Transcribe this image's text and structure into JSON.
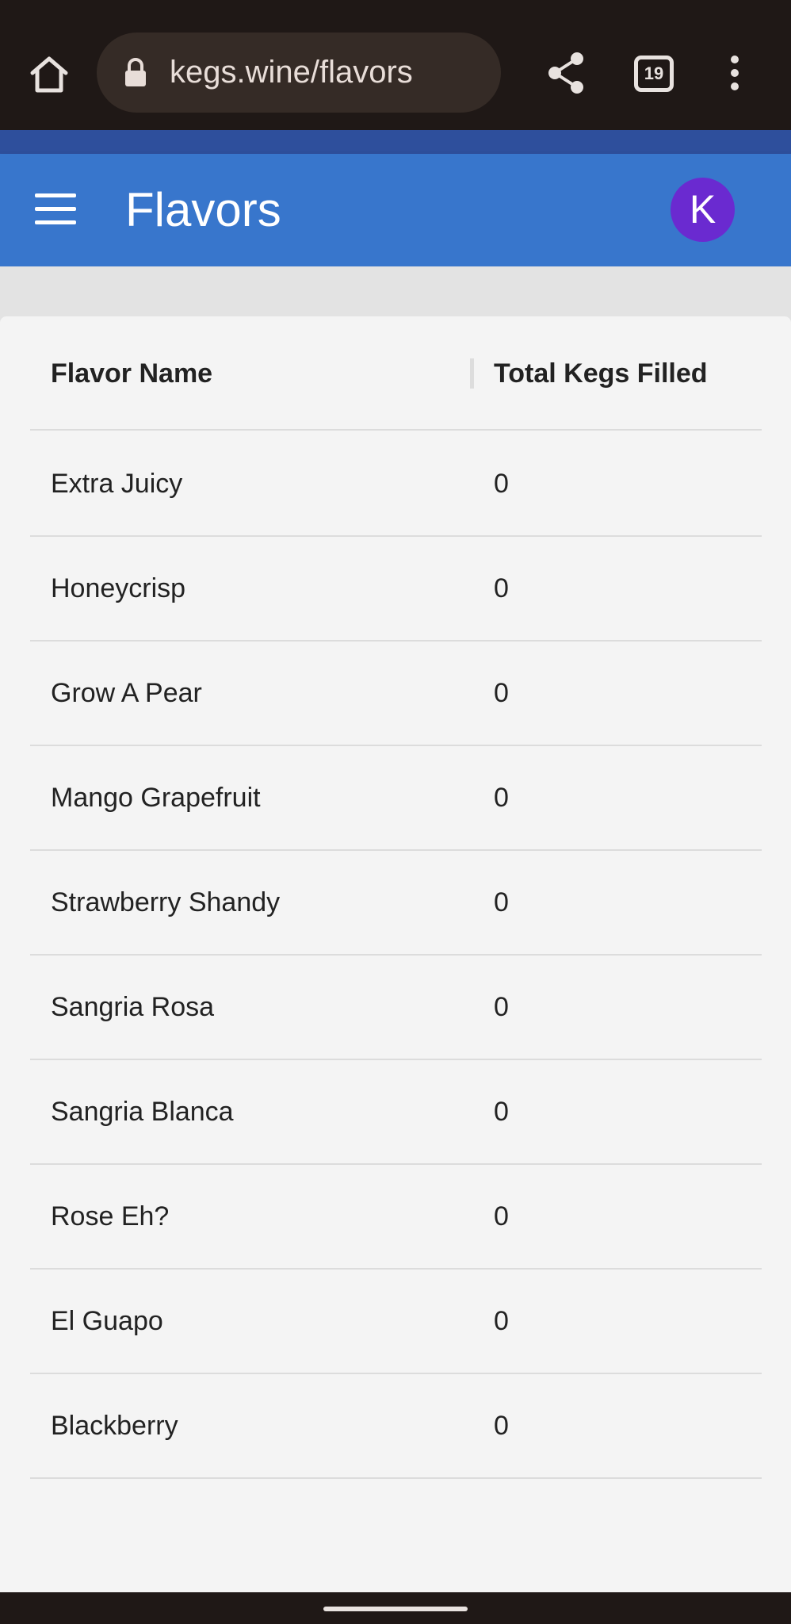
{
  "browser": {
    "url": "kegs.wine/flavors",
    "tab_count": "19"
  },
  "header": {
    "title": "Flavors",
    "avatar_initial": "K",
    "accent_color": "#3876cc",
    "avatar_color": "#6a2ad0"
  },
  "table": {
    "columns": [
      "Flavor Name",
      "Total Kegs Filled"
    ],
    "rows": [
      {
        "name": "Extra Juicy",
        "kegs": "0"
      },
      {
        "name": "Honeycrisp",
        "kegs": "0"
      },
      {
        "name": "Grow A Pear",
        "kegs": "0"
      },
      {
        "name": "Mango Grapefruit",
        "kegs": "0"
      },
      {
        "name": "Strawberry Shandy",
        "kegs": "0"
      },
      {
        "name": "Sangria Rosa",
        "kegs": "0"
      },
      {
        "name": "Sangria Blanca",
        "kegs": "0"
      },
      {
        "name": "Rose Eh?",
        "kegs": "0"
      },
      {
        "name": "El Guapo",
        "kegs": "0"
      },
      {
        "name": "Blackberry",
        "kegs": "0"
      }
    ]
  }
}
